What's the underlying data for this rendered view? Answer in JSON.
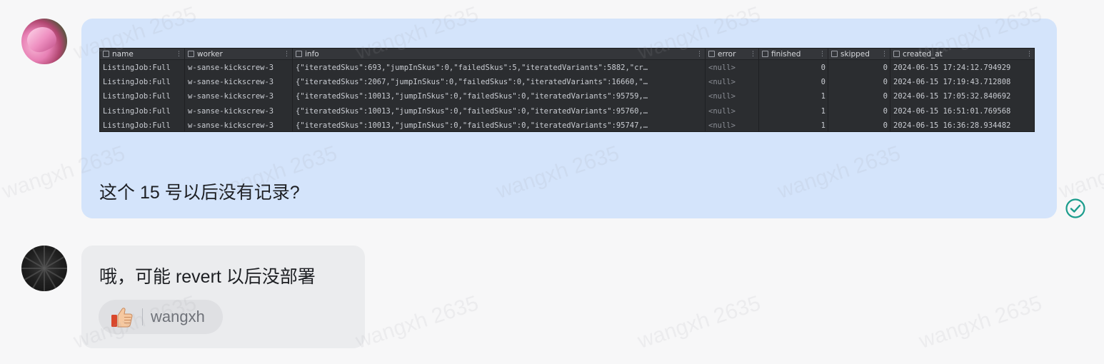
{
  "messages": [
    {
      "table": {
        "columns": [
          {
            "label": "name"
          },
          {
            "label": "worker"
          },
          {
            "label": "info"
          },
          {
            "label": "error"
          },
          {
            "label": "finished"
          },
          {
            "label": "skipped"
          },
          {
            "label": "created_at"
          }
        ],
        "rows": [
          [
            "ListingJob:Full",
            "w-sanse-kickscrew-3",
            "{\"iteratedSkus\":693,\"jumpInSkus\":0,\"failedSkus\":5,\"iteratedVariants\":5882,\"cr…",
            "<null>",
            "0",
            "0",
            "2024-06-15 17:24:12.794929"
          ],
          [
            "ListingJob:Full",
            "w-sanse-kickscrew-3",
            "{\"iteratedSkus\":2067,\"jumpInSkus\":0,\"failedSkus\":0,\"iteratedVariants\":16660,\"…",
            "<null>",
            "0",
            "0",
            "2024-06-15 17:19:43.712808"
          ],
          [
            "ListingJob:Full",
            "w-sanse-kickscrew-3",
            "{\"iteratedSkus\":10013,\"jumpInSkus\":0,\"failedSkus\":0,\"iteratedVariants\":95759,…",
            "<null>",
            "1",
            "0",
            "2024-06-15 17:05:32.840692"
          ],
          [
            "ListingJob:Full",
            "w-sanse-kickscrew-3",
            "{\"iteratedSkus\":10013,\"jumpInSkus\":0,\"failedSkus\":0,\"iteratedVariants\":95760,…",
            "<null>",
            "1",
            "0",
            "2024-06-15 16:51:01.769568"
          ],
          [
            "ListingJob:Full",
            "w-sanse-kickscrew-3",
            "{\"iteratedSkus\":10013,\"jumpInSkus\":0,\"failedSkus\":0,\"iteratedVariants\":95747,…",
            "<null>",
            "1",
            "0",
            "2024-06-15 16:36:28.934482"
          ]
        ]
      },
      "text": "这个 15 号以后没有记录?"
    },
    {
      "text": "哦，可能 revert 以后没部署",
      "reaction": {
        "emoji": "thumbs-up",
        "user": "wangxh"
      }
    }
  ],
  "watermark": "wangxh 2635",
  "colors": {
    "bubble_self": "#d4e4fb",
    "bubble_other": "#ebecee",
    "read_check": "#1a9c8c"
  }
}
